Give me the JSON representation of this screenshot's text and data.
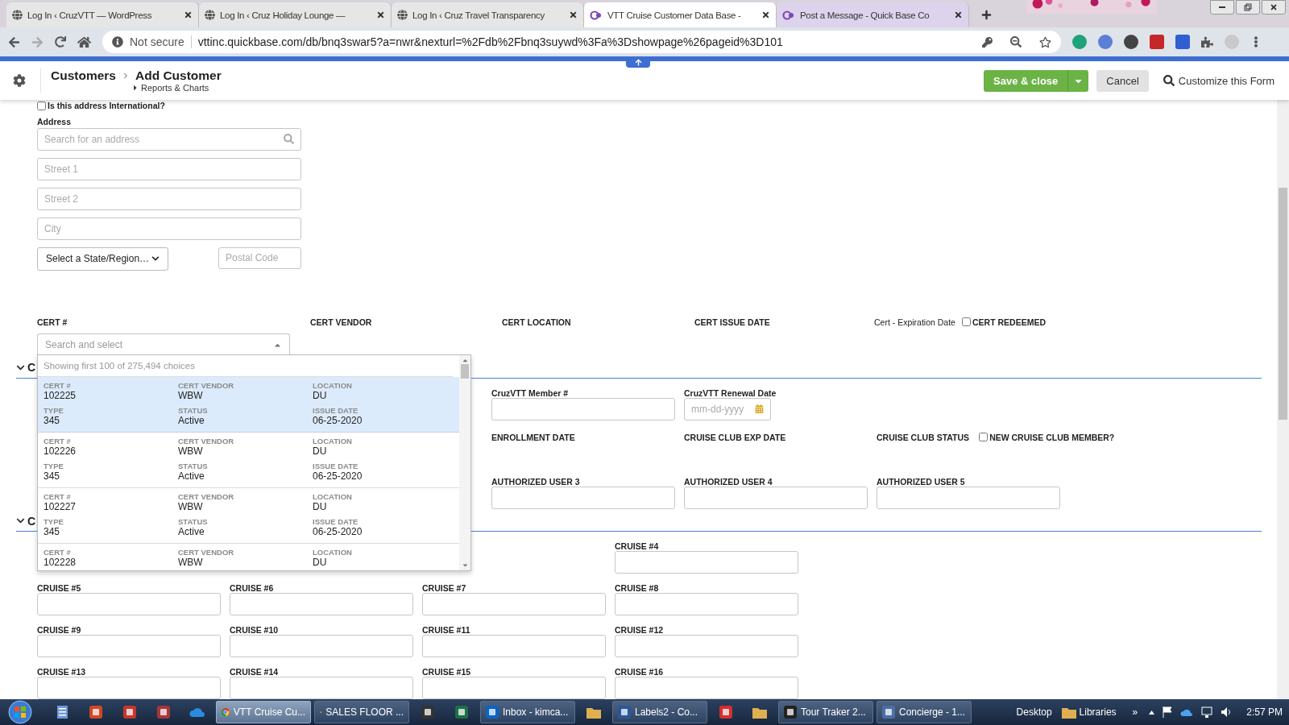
{
  "browser": {
    "tabs": [
      {
        "title": "Log In ‹ CruzVTT — WordPress",
        "selected": false
      },
      {
        "title": "Log In ‹ Cruz Holiday Lounge —",
        "selected": false
      },
      {
        "title": "Log In ‹ Cruz Travel Transparency",
        "selected": false
      },
      {
        "title": "VTT Cruise Customer Data Base -",
        "selected": true
      },
      {
        "title": "Post a Message - Quick Base Co",
        "selected": false
      }
    ],
    "security": "Not secure",
    "url": "vttinc.quickbase.com/db/bnq3swar5?a=nwr&nexturl=%2Fdb%2Fbnq3suywd%3Fa%3Dshowpage%26pageid%3D101"
  },
  "header": {
    "breadcrumb": [
      "Customers",
      "Add Customer"
    ],
    "sublink": "Reports & Charts",
    "save_button": "Save & close",
    "cancel_button": "Cancel",
    "customize_button": "Customize this Form"
  },
  "address": {
    "international": {
      "label": "Is this address International?",
      "checked": false
    },
    "label": "Address",
    "search_placeholder": "Search for an address",
    "fields": [
      {
        "placeholder": "Street 1"
      },
      {
        "placeholder": "Street 2"
      },
      {
        "placeholder": "City"
      }
    ],
    "state_select": "Select a State/Region…",
    "postal_placeholder": "Postal Code"
  },
  "cert": {
    "labels": [
      "CERT #",
      "CERT VENDOR",
      "CERT LOCATION",
      "CERT ISSUE DATE",
      "Cert - Expiration Date"
    ],
    "redeemed": {
      "label": "CERT REDEEMED",
      "checked": false
    },
    "select_placeholder": "Search and select",
    "dropdown": {
      "summary": "Showing first 100 of 275,494 choices",
      "items": [
        {
          "selected": true,
          "fields": [
            {
              "label": "CERT #",
              "value": "102225"
            },
            {
              "label": "CERT VENDOR",
              "value": "WBW"
            },
            {
              "label": "LOCATION",
              "value": "DU"
            },
            {
              "label": "TYPE",
              "value": "345"
            },
            {
              "label": "STATUS",
              "value": "Active"
            },
            {
              "label": "ISSUE DATE",
              "value": "06-25-2020"
            }
          ]
        },
        {
          "selected": false,
          "fields": [
            {
              "label": "CERT #",
              "value": "102226"
            },
            {
              "label": "CERT VENDOR",
              "value": "WBW"
            },
            {
              "label": "LOCATION",
              "value": "DU"
            },
            {
              "label": "TYPE",
              "value": "345"
            },
            {
              "label": "STATUS",
              "value": "Active"
            },
            {
              "label": "ISSUE DATE",
              "value": "06-25-2020"
            }
          ]
        },
        {
          "selected": false,
          "fields": [
            {
              "label": "CERT #",
              "value": "102227"
            },
            {
              "label": "CERT VENDOR",
              "value": "WBW"
            },
            {
              "label": "LOCATION",
              "value": "DU"
            },
            {
              "label": "TYPE",
              "value": "345"
            },
            {
              "label": "STATUS",
              "value": "Active"
            },
            {
              "label": "ISSUE DATE",
              "value": "06-25-2020"
            }
          ]
        },
        {
          "selected": false,
          "fields": [
            {
              "label": "CERT #",
              "value": "102228"
            },
            {
              "label": "CERT VENDOR",
              "value": "WBW"
            },
            {
              "label": "LOCATION",
              "value": "DU"
            }
          ]
        }
      ]
    }
  },
  "member_section": {
    "title": "C",
    "expanded": true,
    "rows": [
      [
        {
          "kind": "text",
          "label": "CruzVTT Member #"
        },
        {
          "kind": "date",
          "label": "CruzVTT Renewal Date",
          "placeholder": "mm-dd-yyyy"
        }
      ],
      [
        {
          "kind": "label",
          "label": "ENROLLMENT DATE"
        },
        {
          "kind": "label",
          "label": "CRUISE CLUB EXP DATE"
        },
        {
          "kind": "flag",
          "label": "CRUISE CLUB STATUS",
          "checkbox_label": "NEW CRUISE CLUB MEMBER?",
          "checked": false
        }
      ],
      [
        {
          "kind": "text",
          "label": "AUTHORIZED USER 3"
        },
        {
          "kind": "text",
          "label": "AUTHORIZED USER 4"
        },
        {
          "kind": "text",
          "label": "AUTHORIZED USER 5"
        }
      ]
    ]
  },
  "cruise_section": {
    "title": "C",
    "expanded": true,
    "fields": [
      "CRUISE #4",
      "CRUISE #5",
      "CRUISE #6",
      "CRUISE #7",
      "CRUISE #8",
      "CRUISE #9",
      "CRUISE #10",
      "CRUISE #11",
      "CRUISE #12",
      "CRUISE #13",
      "CRUISE #14",
      "CRUISE #15",
      "CRUISE #16"
    ]
  },
  "taskbar": {
    "items": [
      {
        "kind": "pinned"
      },
      {
        "kind": "pinned"
      },
      {
        "kind": "pinned"
      },
      {
        "kind": "pinned"
      },
      {
        "kind": "pinned"
      },
      {
        "kind": "window",
        "label": "VTT Cruise Cu...",
        "selected": true
      },
      {
        "kind": "window",
        "label": "SALES FLOOR ...",
        "selected": false
      },
      {
        "kind": "pinned"
      },
      {
        "kind": "pinned"
      },
      {
        "kind": "window",
        "label": "Inbox - kimca...",
        "selected": false
      },
      {
        "kind": "pinned"
      },
      {
        "kind": "window",
        "label": "Labels2 - Co...",
        "selected": false
      },
      {
        "kind": "pinned"
      },
      {
        "kind": "pinned"
      },
      {
        "kind": "window",
        "label": "Tour Traker 2...",
        "selected": false
      },
      {
        "kind": "window",
        "label": "Concierge - 1...",
        "selected": false
      }
    ],
    "desktop": "Desktop",
    "libraries": "Libraries",
    "overflow": "»",
    "clock": "2:57 PM"
  }
}
